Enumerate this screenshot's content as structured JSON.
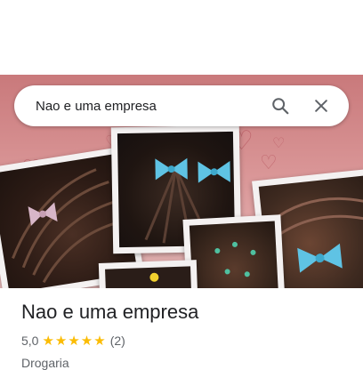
{
  "search": {
    "query": "Nao e uma empresa",
    "search_icon": "search-icon",
    "close_icon": "close-icon"
  },
  "place": {
    "name": "Nao e uma empresa",
    "rating": "5,0",
    "stars": "★★★★★",
    "review_count": "(2)",
    "category": "Drogaria"
  },
  "colors": {
    "hero_bg": "#d38a8b",
    "bow_blue": "#5fc3e4",
    "bow_pink": "#d8b6c8",
    "star": "#fbbc04",
    "text_primary": "#202124",
    "text_secondary": "#5f6368"
  }
}
